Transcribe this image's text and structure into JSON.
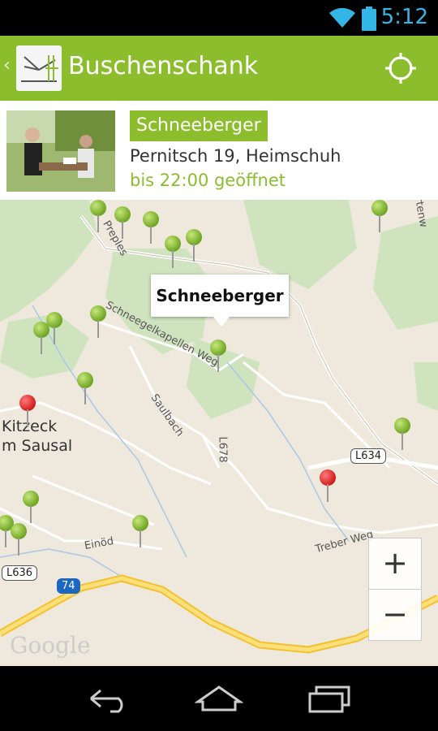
{
  "status_bar": {
    "time": "5:12"
  },
  "action_bar": {
    "title": "Buschenschank"
  },
  "selected": {
    "name": "Schneeberger",
    "address": "Pernitsch 19, Heimschuh",
    "hours": "bis 22:00 geöffnet"
  },
  "map": {
    "popup_title": "Schneeberger",
    "road_labels": [
      {
        "id": "preples",
        "text": "Preples"
      },
      {
        "id": "schneegelkapellen",
        "text": "Schneegelkapellen Weg"
      },
      {
        "id": "sausal",
        "text": "Saulbach"
      },
      {
        "id": "l678",
        "text": "L678"
      },
      {
        "id": "einod",
        "text": "Einöd"
      },
      {
        "id": "treber",
        "text": "Treber Weg"
      },
      {
        "id": "rtenw",
        "text": "rtenw"
      }
    ],
    "towns": [
      {
        "text": "Kitzeck"
      },
      {
        "text": "m Sausal"
      }
    ],
    "shields": [
      {
        "text": "L634"
      },
      {
        "text": "L636"
      },
      {
        "text": "74"
      }
    ],
    "zoom": {
      "in": "+",
      "out": "−"
    },
    "attribution": "Google",
    "pins": {
      "green_count": 16,
      "red_count": 2
    }
  },
  "icons": {
    "wifi": "wifi-icon",
    "battery": "battery-icon",
    "locate": "my-location-icon",
    "back": "back-icon",
    "home": "home-icon",
    "recent": "recent-apps-icon"
  },
  "colors": {
    "accent": "#8cbd2c",
    "status_time": "#33b5e5",
    "pin_green": "#6ea522",
    "pin_red": "#d21c1c"
  }
}
